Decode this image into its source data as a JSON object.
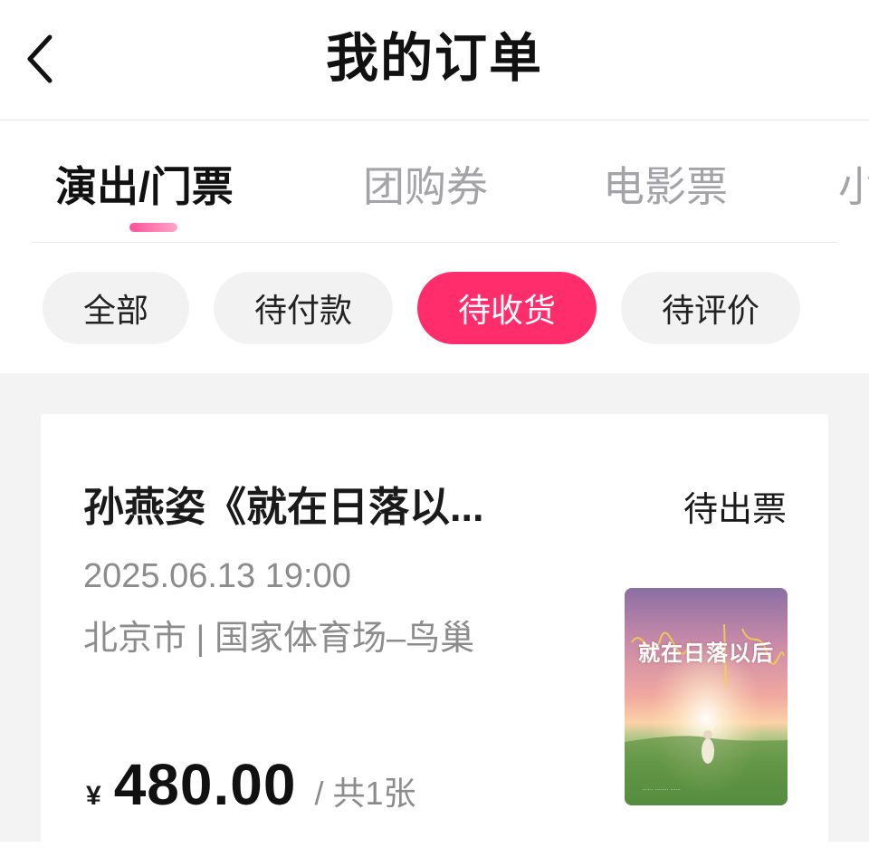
{
  "header": {
    "title": "我的订单",
    "back_icon": "chevron-left-icon"
  },
  "tabs": [
    {
      "label": "演出/门票",
      "active": true
    },
    {
      "label": "团购券",
      "active": false
    },
    {
      "label": "电影票",
      "active": false
    },
    {
      "label": "小",
      "active": false
    }
  ],
  "filters": [
    {
      "label": "全部",
      "active": false
    },
    {
      "label": "待付款",
      "active": false
    },
    {
      "label": "待收货",
      "active": true
    },
    {
      "label": "待评价",
      "active": false
    }
  ],
  "order": {
    "title": "孙燕姿《就在日落以...",
    "status": "待出票",
    "datetime": "2025.06.13 19:00",
    "venue": "北京市 | 国家体育场–鸟巢",
    "currency": "¥",
    "price": "480.00",
    "quantity": "/ 共1张",
    "poster": {
      "title": "就在日落以后"
    }
  },
  "colors": {
    "accent": "#ff2d6b",
    "tab_underline": "#ff4f9a",
    "muted_text": "#8c8c8c",
    "chip_bg": "#f2f2f3",
    "list_bg": "#f3f3f3"
  }
}
